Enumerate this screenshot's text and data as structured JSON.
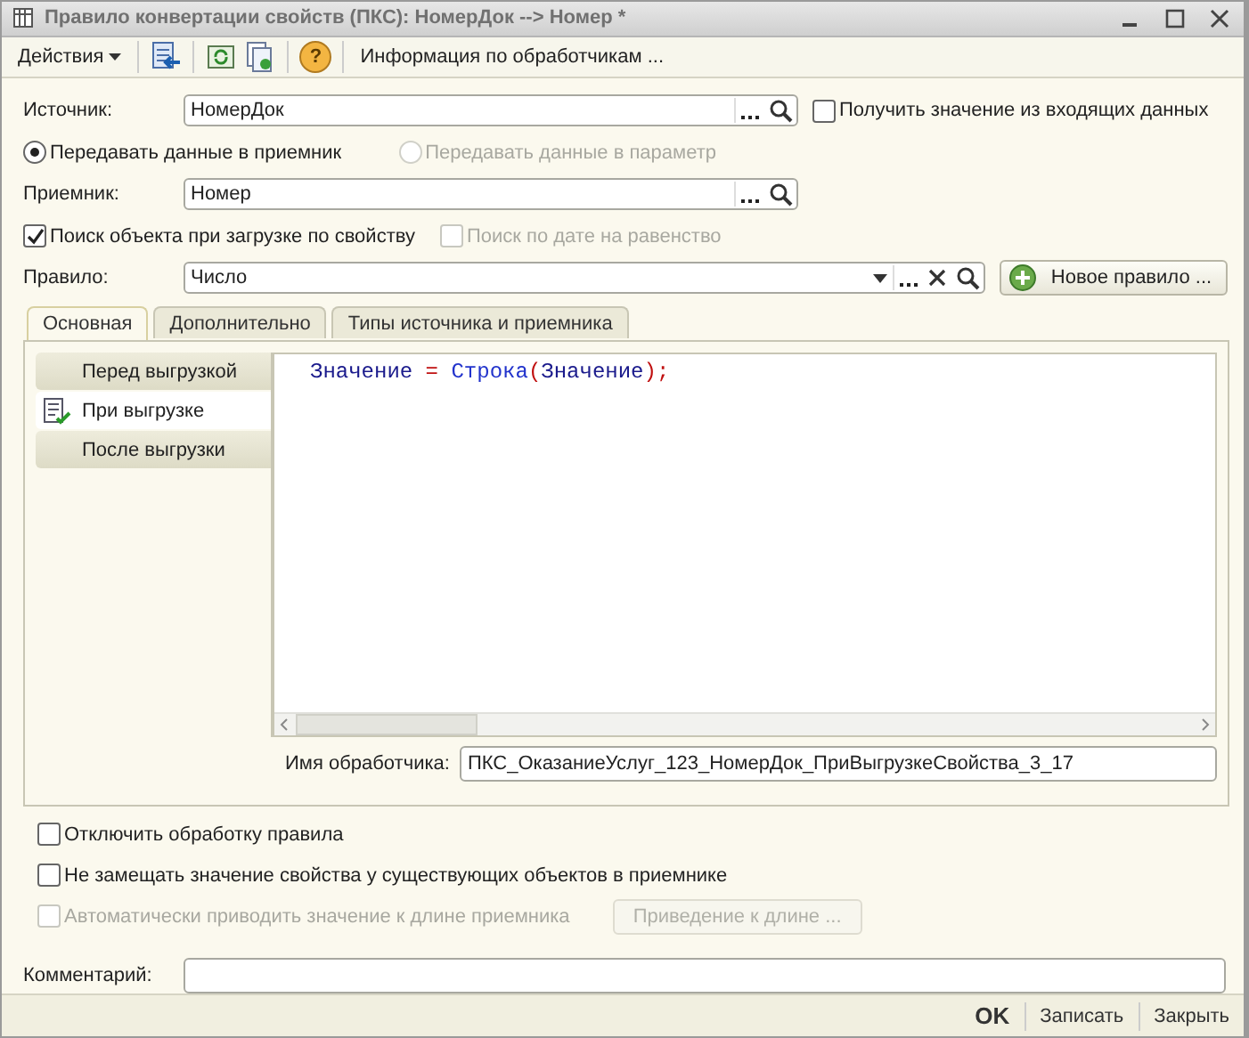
{
  "window": {
    "title": "Правило конвертации свойств (ПКС): НомерДок --> Номер *"
  },
  "toolbar": {
    "actions_menu": "Действия",
    "help": "?",
    "info_button": "Информация по обработчикам ..."
  },
  "source": {
    "label": "Источник:",
    "value": "НомерДок",
    "checkbox": {
      "label": "Получить значение из входящих данных",
      "checked": false
    }
  },
  "transfer_options": [
    {
      "label": "Передавать данные в приемник",
      "selected": true,
      "disabled": false
    },
    {
      "label": "Передавать данные в параметр",
      "selected": false,
      "disabled": true
    }
  ],
  "receiver": {
    "label": "Приемник:",
    "value": "Номер"
  },
  "search_options": [
    {
      "label": "Поиск объекта при загрузке по свойству",
      "checked": true,
      "disabled": false
    },
    {
      "label": "Поиск по дате на равенство",
      "checked": false,
      "disabled": true
    }
  ],
  "rule": {
    "label": "Правило:",
    "value": "Число",
    "new_rule_button": "Новое правило ..."
  },
  "tabs": [
    {
      "label": "Основная",
      "selected": true
    },
    {
      "label": "Дополнительно",
      "selected": false
    },
    {
      "label": "Типы источника и приемника",
      "selected": false
    }
  ],
  "handlers": [
    {
      "label": "Перед выгрузкой",
      "selected": false
    },
    {
      "label": "При выгрузке",
      "selected": true
    },
    {
      "label": "После выгрузки",
      "selected": false
    }
  ],
  "code": [
    {
      "text": "Значение",
      "kind": "variable"
    },
    {
      "text": " = ",
      "kind": "operator"
    },
    {
      "text": "Строка",
      "kind": "function"
    },
    {
      "text": "(",
      "kind": "operator"
    },
    {
      "text": "Значение",
      "kind": "variable"
    },
    {
      "text": ");",
      "kind": "operator"
    }
  ],
  "handler_name": {
    "label": "Имя обработчика:",
    "value": "ПКС_ОказаниеУслуг_123_НомерДок_ПриВыгрузкеСвойства_3_17"
  },
  "options": [
    {
      "label": "Отключить обработку правила",
      "checked": false,
      "disabled": false
    },
    {
      "label": "Не замещать значение свойства у существующих объектов в приемнике",
      "checked": false,
      "disabled": false
    },
    {
      "label": "Автоматически приводить значение к длине приемника",
      "checked": false,
      "disabled": true
    }
  ],
  "length_button": {
    "label": "Приведение к длине ...",
    "disabled": true
  },
  "comment": {
    "label": "Комментарий:"
  },
  "footer_buttons": [
    {
      "label": "OK",
      "kind": "default"
    },
    {
      "label": "Записать",
      "kind": "normal"
    },
    {
      "label": "Закрыть",
      "kind": "normal"
    }
  ]
}
